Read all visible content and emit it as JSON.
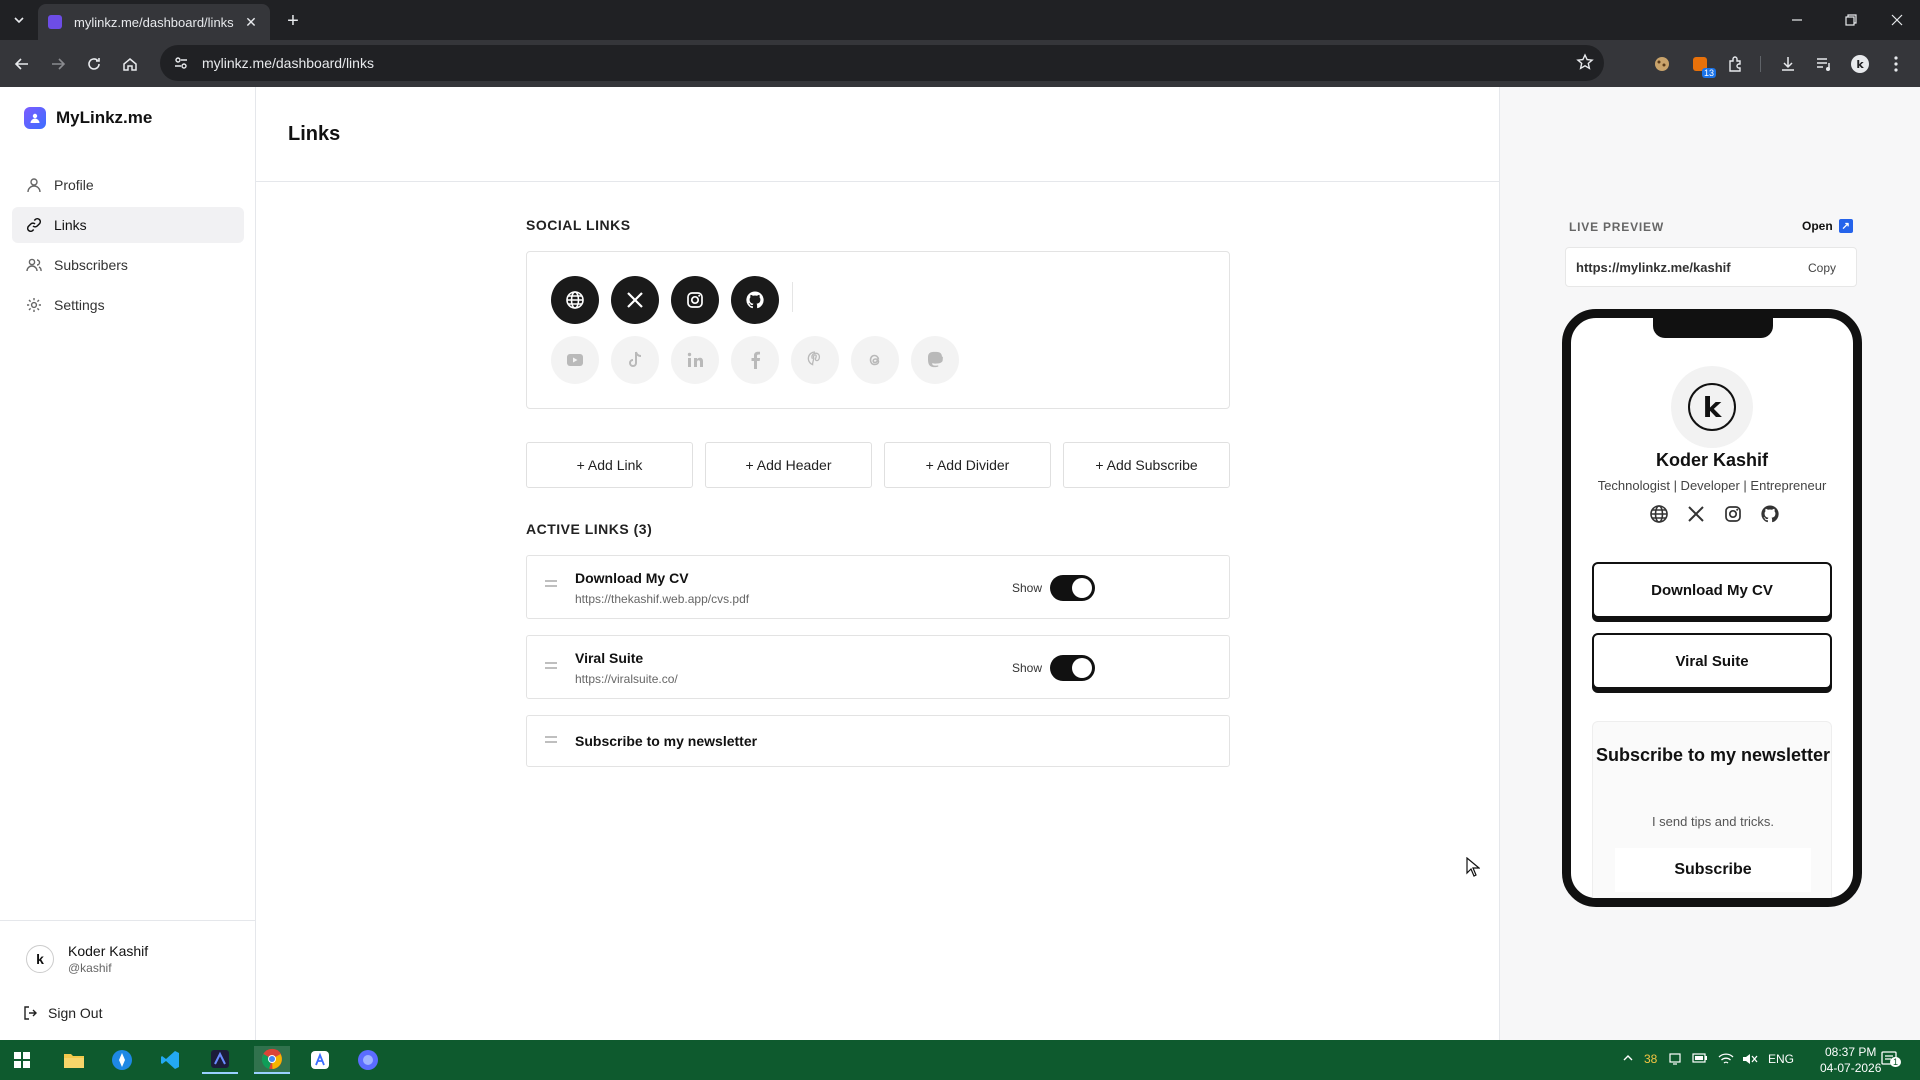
{
  "browser": {
    "tab_title": "mylinkz.me/dashboard/links",
    "url": "mylinkz.me/dashboard/links",
    "extension_badge": "13"
  },
  "sidebar": {
    "brand": "MyLinkz.me",
    "items": [
      {
        "label": "Profile",
        "icon": "user-icon"
      },
      {
        "label": "Links",
        "icon": "link-icon"
      },
      {
        "label": "Subscribers",
        "icon": "users-icon"
      },
      {
        "label": "Settings",
        "icon": "gear-icon"
      }
    ],
    "active": "Links",
    "user": {
      "name": "Koder Kashif",
      "handle": "@kashif",
      "avatar_letter": "k"
    },
    "sign_out": "Sign Out"
  },
  "main": {
    "title": "Links",
    "social_title": "SOCIAL LINKS",
    "social_active": [
      "globe-icon",
      "x-icon",
      "instagram-icon",
      "github-icon"
    ],
    "social_inactive": [
      "youtube-icon",
      "tiktok-icon",
      "linkedin-icon",
      "facebook-icon",
      "pinterest-icon",
      "threads-icon",
      "mastodon-icon"
    ],
    "add_buttons": [
      "+ Add Link",
      "+ Add Header",
      "+ Add Divider",
      "+ Add Subscribe"
    ],
    "active_title": "ACTIVE LINKS (3)",
    "links": [
      {
        "title": "Download My CV",
        "url": "https://thekashif.web.app/cvs.pdf",
        "show_label": "Show",
        "shown": true
      },
      {
        "title": "Viral Suite",
        "url": "https://viralsuite.co/",
        "show_label": "Show",
        "shown": true
      },
      {
        "title": "Subscribe to my newsletter"
      }
    ]
  },
  "preview": {
    "label": "LIVE PREVIEW",
    "open": "Open",
    "url": "https://mylinkz.me/kashif",
    "copy": "Copy",
    "avatar_letter": "k",
    "name": "Koder Kashif",
    "bio": "Technologist | Developer | Entrepreneur",
    "buttons": [
      "Download My CV",
      "Viral Suite"
    ],
    "subscribe_title": "Subscribe to my newsletter",
    "subscribe_desc": "I send tips and tricks.",
    "subscribe_button": "Subscribe"
  },
  "taskbar": {
    "tray_temp": "38",
    "lang": "ENG",
    "time": "08:37 PM",
    "date": "04-07-2026",
    "notif": "1"
  },
  "colors": {
    "accent": "#111111",
    "brand": "#6d4de6",
    "taskbar": "#0e5a2e"
  }
}
